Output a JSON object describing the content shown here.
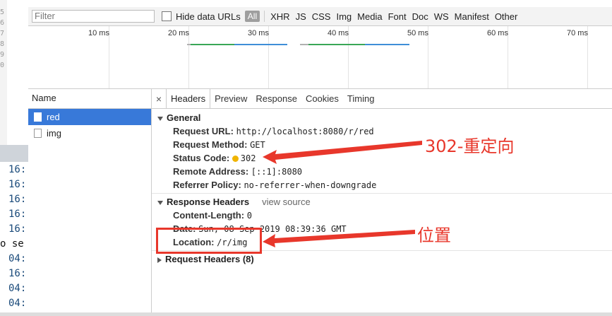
{
  "toolbar": {
    "filter_placeholder": "Filter",
    "hide_data_urls": "Hide data URLs",
    "types": [
      "All",
      "XHR",
      "JS",
      "CSS",
      "Img",
      "Media",
      "Font",
      "Doc",
      "WS",
      "Manifest",
      "Other"
    ]
  },
  "timeline": {
    "ticks": [
      "10 ms",
      "20 ms",
      "30 ms",
      "40 ms",
      "50 ms",
      "60 ms",
      "70 ms"
    ]
  },
  "gutter": [
    "5",
    "6",
    "7",
    "8",
    "9",
    "0"
  ],
  "console": {
    "lines": [
      "16:",
      "16:",
      "16:",
      "16:",
      "16:",
      "o se",
      "04:",
      "16:",
      "04:",
      "04:"
    ]
  },
  "name_col": {
    "header": "Name",
    "rows": [
      "red",
      "img"
    ]
  },
  "tabs": [
    "Headers",
    "Preview",
    "Response",
    "Cookies",
    "Timing"
  ],
  "general": {
    "title": "General",
    "request_url_k": "Request URL:",
    "request_url_v": "http://localhost:8080/r/red",
    "request_method_k": "Request Method:",
    "request_method_v": "GET",
    "status_code_k": "Status Code:",
    "status_code_v": "302",
    "remote_address_k": "Remote Address:",
    "remote_address_v": "[::1]:8080",
    "referrer_k": "Referrer Policy:",
    "referrer_v": "no-referrer-when-downgrade"
  },
  "response_headers": {
    "title": "Response Headers",
    "view_source": "view source",
    "content_length_k": "Content-Length:",
    "content_length_v": "0",
    "date_k": "Date:",
    "date_v": "Sun, 08 Sep 2019 08:39:36 GMT",
    "location_k": "Location:",
    "location_v": "/r/img"
  },
  "request_headers": {
    "title": "Request Headers (8)"
  },
  "annotations": {
    "redirect_label": "302-重定向",
    "location_label": "位置",
    "color": "#e8372b"
  }
}
